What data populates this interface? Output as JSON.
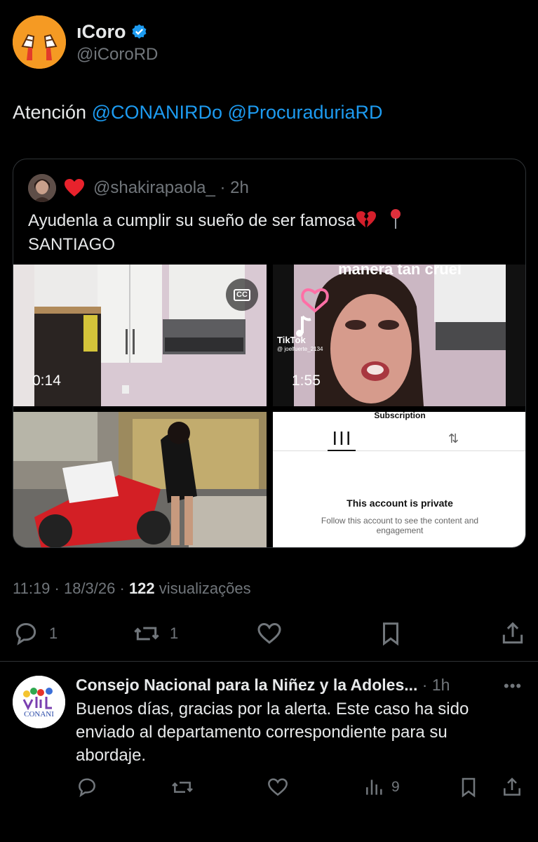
{
  "post": {
    "display_name": "ıCoro",
    "handle": "@iCoroRD",
    "text_prefix": "Atención",
    "mention1": "@CONANIRDo",
    "mention2": "@ProcuraduriaRD",
    "timestamp": "11:19 · 18/3/26 ·",
    "views_count": "122",
    "views_label": "visualizações",
    "replies": "1",
    "reposts": "1"
  },
  "quote": {
    "handle_time": "@shakirapaola_ · 2h",
    "text_line1": "Ayudenla a cumplir su sueño de ser famosa",
    "text_line2": "SANTIAGO",
    "media": [
      {
        "duration": "0:14"
      },
      {
        "duration": "1:55",
        "caption": "manera tan cruel",
        "watermark": "TikTok",
        "watermark_user": "@ joelfuerte_2134"
      },
      {},
      {
        "header": "Subscription",
        "title": "This account is private",
        "subtitle": "Follow this account to see the content and engagement"
      }
    ]
  },
  "reply": {
    "name": "Consejo Nacional para la Niñez y la Adoles...",
    "time": " · 1h",
    "text": "Buenos días, gracias por la alerta. Este caso ha sido enviado al departamento correspondiente para su abordaje.",
    "views": "9",
    "avatar_text": "CONANI"
  },
  "colors": {
    "background": "#000000",
    "link": "#1d9bf0",
    "muted": "#71767b",
    "verified": "#1d9bf0"
  }
}
